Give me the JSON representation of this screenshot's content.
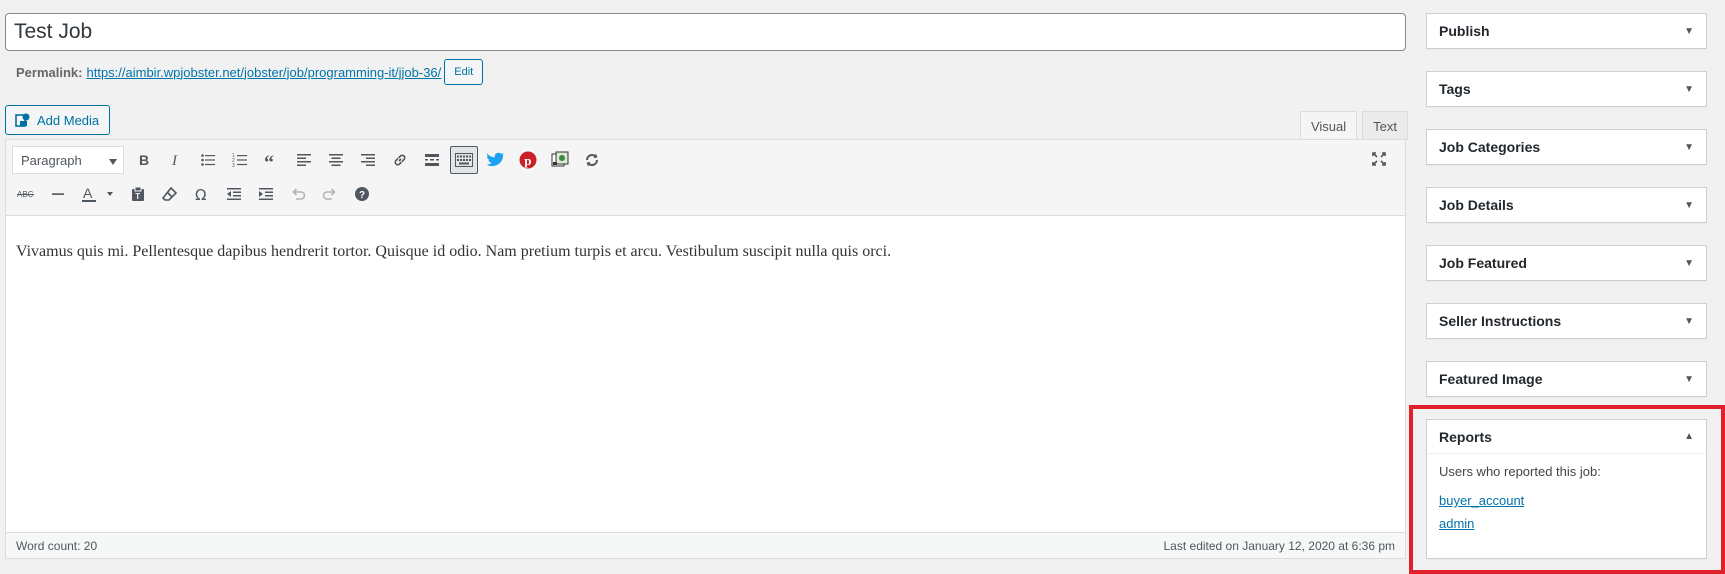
{
  "post": {
    "title": "Test Job",
    "permalink_label": "Permalink:",
    "permalink_url": "https://aimbir.wpjobster.net/jobster/job/programming-it/jjob-36/",
    "edit_label": "Edit"
  },
  "media": {
    "add_media_label": "Add Media"
  },
  "editor": {
    "tabs": [
      "Visual",
      "Text"
    ],
    "active_tab": "Visual",
    "format_value": "Paragraph",
    "content": "Vivamus quis mi. Pellentesque dapibus hendrerit tortor. Quisque id odio. Nam pretium turpis et arcu. Vestibulum suscipit nulla quis orci.",
    "word_count": "Word count: 20",
    "last_edited": "Last edited on January 12, 2020 at 6:36 pm",
    "toolbar_row1": [
      "bold-icon",
      "italic-icon",
      "bulleted-list-icon",
      "numbered-list-icon",
      "blockquote-icon",
      "align-left-icon",
      "align-center-icon",
      "align-right-icon",
      "link-icon",
      "read-more-icon",
      "toolbar-toggle-icon",
      "twitter-icon",
      "pinterest-icon",
      "image-map-icon",
      "refresh-icon"
    ],
    "toolbar_row2": [
      "strikethrough-icon",
      "horizontal-line-icon",
      "text-color-icon",
      "paste-text-icon",
      "clear-formatting-icon",
      "special-character-icon",
      "outdent-icon",
      "indent-icon",
      "undo-icon",
      "redo-icon",
      "help-icon"
    ]
  },
  "sidebar": {
    "boxes": [
      {
        "title": "Publish",
        "state": "collapsed"
      },
      {
        "title": "Tags",
        "state": "collapsed"
      },
      {
        "title": "Job Categories",
        "state": "collapsed"
      },
      {
        "title": "Job Details",
        "state": "collapsed"
      },
      {
        "title": "Job Featured",
        "state": "collapsed"
      },
      {
        "title": "Seller Instructions",
        "state": "collapsed"
      },
      {
        "title": "Featured Image",
        "state": "collapsed"
      },
      {
        "title": "Reports",
        "state": "expanded"
      }
    ],
    "reports": {
      "intro": "Users who reported this job:",
      "users": [
        "buyer_account",
        "admin"
      ]
    }
  },
  "colors": {
    "accent": "#0073aa",
    "highlight": "#e0202a",
    "twitter": "#1da1f2",
    "pinterest": "#cb2027"
  }
}
